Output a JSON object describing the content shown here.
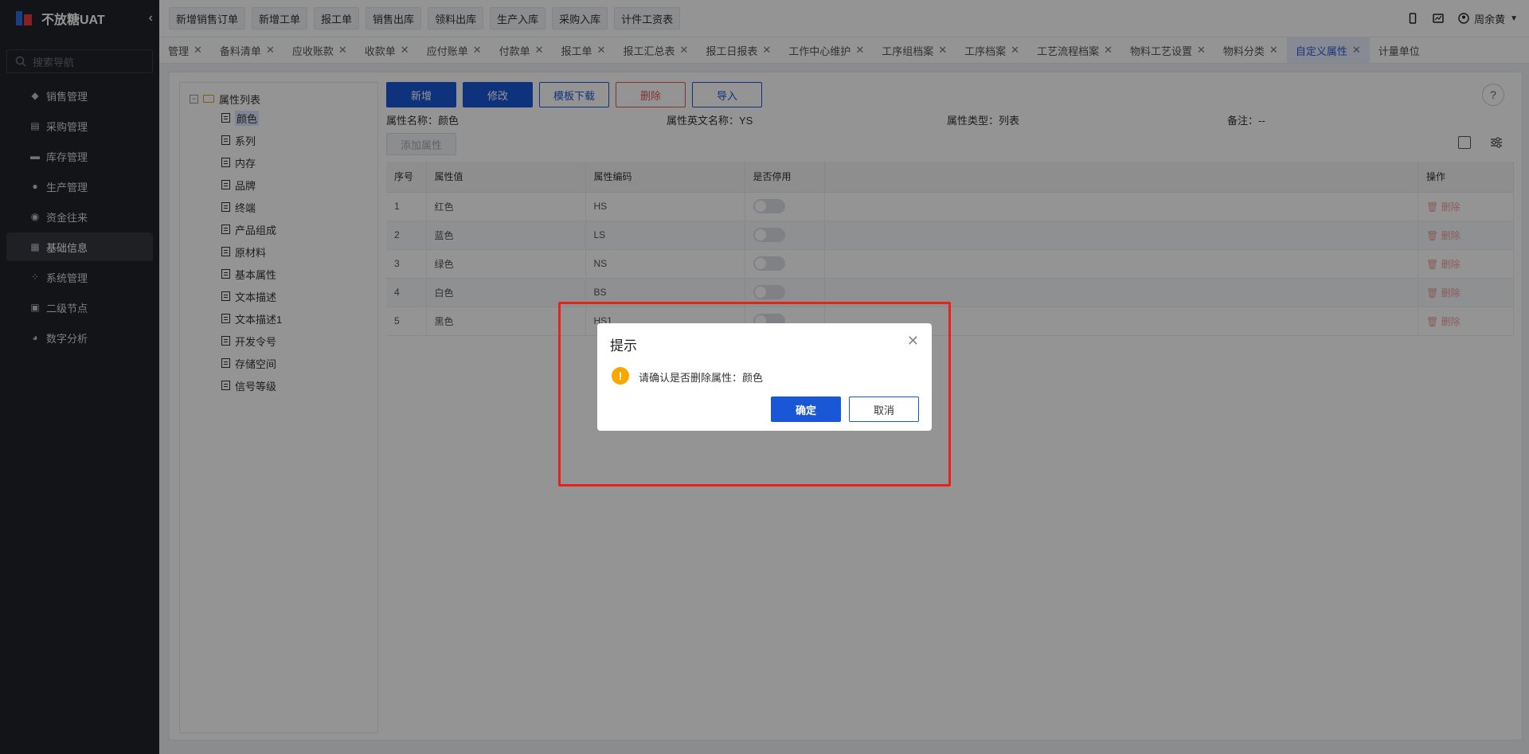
{
  "sidebar": {
    "brand": "不放糖UAT",
    "search_placeholder": "搜索导航",
    "items": [
      {
        "label": "销售管理",
        "icon": "tag-icon"
      },
      {
        "label": "采购管理",
        "icon": "cart-icon"
      },
      {
        "label": "库存管理",
        "icon": "warehouse-icon"
      },
      {
        "label": "生产管理",
        "icon": "factory-icon"
      },
      {
        "label": "资金往来",
        "icon": "money-icon"
      },
      {
        "label": "基础信息",
        "icon": "grid-icon"
      },
      {
        "label": "系统管理",
        "icon": "apps-icon"
      },
      {
        "label": "二级节点",
        "icon": "file-icon"
      },
      {
        "label": "数字分析",
        "icon": "pie-icon"
      }
    ]
  },
  "topbar": {
    "quick_actions": [
      "新增销售订单",
      "新增工单",
      "报工单",
      "销售出库",
      "领料出库",
      "生产入库",
      "采购入库",
      "计件工资表"
    ],
    "user": "周余黄"
  },
  "tabs": [
    "管理",
    "备料清单",
    "应收账款",
    "收款单",
    "应付账单",
    "付款单",
    "报工单",
    "报工汇总表",
    "报工日报表",
    "工作中心维护",
    "工序组档案",
    "工序档案",
    "工艺流程档案",
    "物料工艺设置",
    "物料分类",
    "自定义属性",
    "计量单位"
  ],
  "tree": {
    "root": "属性列表",
    "items": [
      "颜色",
      "系列",
      "内存",
      "品牌",
      "终端",
      "产品组成",
      "原材料",
      "基本属性",
      "文本描述",
      "文本描述1",
      "开发令号",
      "存储空间",
      "信号等级"
    ]
  },
  "toolbar": {
    "add": "新增",
    "edit": "修改",
    "template": "模板下载",
    "delete": "删除",
    "import": "导入",
    "add_attr": "添加属性"
  },
  "info": {
    "name": "属性名称：颜色",
    "en_name": "属性英文名称：YS",
    "type": "属性类型：列表",
    "remark": "备注：--"
  },
  "table": {
    "headers": [
      "序号",
      "属性值",
      "属性编码",
      "是否停用",
      "",
      "操作"
    ],
    "rows": [
      {
        "no": "1",
        "value": "红色",
        "code": "HS",
        "op": "删除"
      },
      {
        "no": "2",
        "value": "蓝色",
        "code": "LS",
        "op": "删除"
      },
      {
        "no": "3",
        "value": "绿色",
        "code": "NS",
        "op": "删除"
      },
      {
        "no": "4",
        "value": "白色",
        "code": "BS",
        "op": "删除"
      },
      {
        "no": "5",
        "value": "黑色",
        "code": "HS1",
        "op": "删除"
      }
    ]
  },
  "dialog": {
    "title": "提示",
    "message": "请确认是否删除属性：颜色",
    "ok": "确定",
    "cancel": "取消"
  }
}
